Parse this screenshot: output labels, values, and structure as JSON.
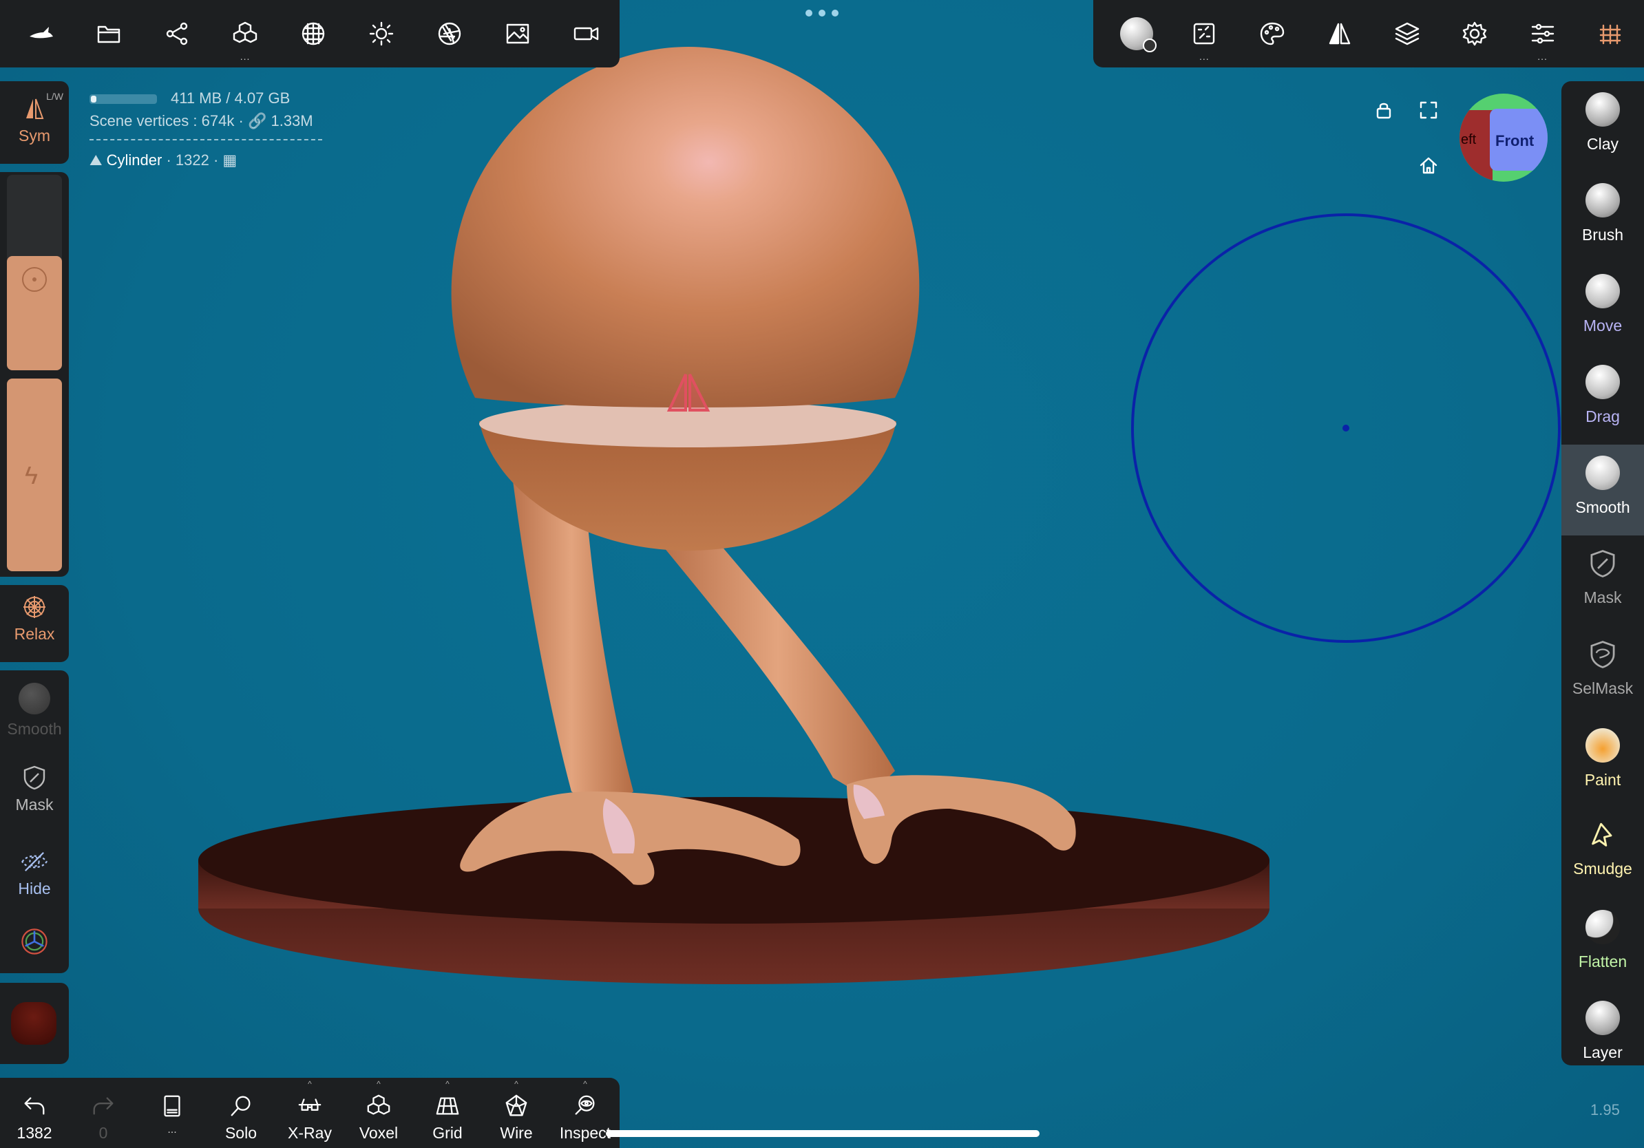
{
  "top_left_toolbar": {
    "icons": [
      "shark-icon",
      "folder-icon",
      "share-icon",
      "cubes-icon",
      "globe-grid-icon",
      "sun-icon",
      "aperture-icon",
      "image-icon",
      "video-camera-icon"
    ]
  },
  "top_right_toolbar": {
    "icons": [
      "brush-settings-icon",
      "stroke-icon",
      "palette-icon",
      "symmetry-icon",
      "layers-icon",
      "gear-icon",
      "sliders-icon",
      "topology-icon"
    ]
  },
  "info": {
    "memory": "411 MB / 4.07 GB",
    "vertices_label": "Scene vertices :",
    "vertices": "674k",
    "faces": "1.33M",
    "object_name": "Cylinder",
    "object_count": "1322"
  },
  "left_panel": {
    "sym_label": "Sym",
    "sym_badge": "L/W",
    "relax_label": "Relax",
    "smooth_label": "Smooth",
    "mask_label": "Mask",
    "hide_label": "Hide"
  },
  "right_tools": [
    {
      "label": "Clay",
      "color": "#ffffff"
    },
    {
      "label": "Brush",
      "color": "#ffffff"
    },
    {
      "label": "Move",
      "color": "#b9b4f5"
    },
    {
      "label": "Drag",
      "color": "#b9b4f5"
    },
    {
      "label": "Smooth",
      "color": "#ffffff"
    },
    {
      "label": "Mask",
      "color": "#a9a9a9"
    },
    {
      "label": "SelMask",
      "color": "#a9a9a9"
    },
    {
      "label": "Paint",
      "color": "#fff3b0"
    },
    {
      "label": "Smudge",
      "color": "#fff3b0"
    },
    {
      "label": "Flatten",
      "color": "#c2f5a8"
    },
    {
      "label": "Layer",
      "color": "#ffffff"
    }
  ],
  "bottom_bar": {
    "undo_count": "1382",
    "redo_count": "0",
    "more": "...",
    "solo": "Solo",
    "xray": "X-Ray",
    "voxel": "Voxel",
    "grid": "Grid",
    "wire": "Wire",
    "inspect": "Inspect"
  },
  "gizmo": {
    "front": "Front",
    "left": "eft"
  },
  "version": "1.95",
  "brush_radius_note": ""
}
